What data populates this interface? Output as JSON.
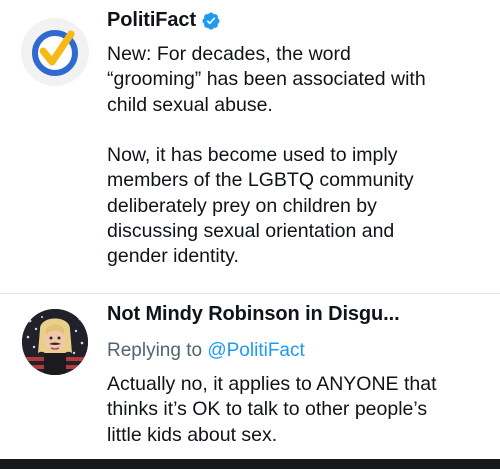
{
  "tweets": [
    {
      "author": "PolitiFact",
      "verified": true,
      "avatar_icon": "politifact-check-logo",
      "text": "New: For decades, the word\n“grooming” has been associated with\nchild sexual abuse.\n\nNow, it has become used to imply\nmembers of the LGBTQ community\ndeliberately prey on children by\ndiscussing sexual orientation and\ngender identity."
    },
    {
      "author": "Not Mindy Robinson in Disgu...",
      "avatar_icon": "user-avatar-photo",
      "replying_prefix": "Replying to ",
      "replying_to": "@PolitiFact",
      "text": "Actually no, it applies to ANYONE that\nthinks it’s OK to talk to other people’s\nlittle kids about sex."
    }
  ],
  "colors": {
    "verified_badge": "#1d9bf0",
    "link": "#1d9bf0",
    "secondary_text": "#536471",
    "logo_ring": "#2f6ad1",
    "logo_check": "#f6b915"
  }
}
